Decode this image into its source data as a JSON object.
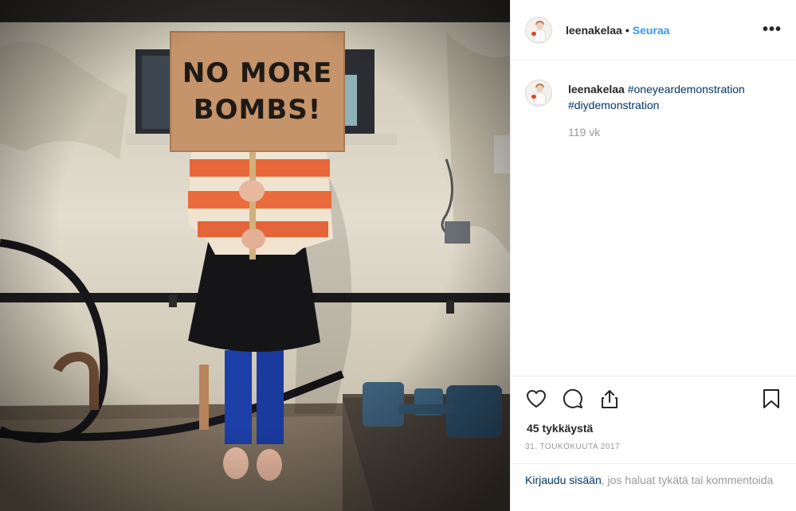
{
  "post": {
    "image": {
      "sign_line1": "NO MORE",
      "sign_line2": "BOMBS!"
    },
    "header": {
      "username": "leenakelaa",
      "dot": "•",
      "follow_label": "Seuraa",
      "more_label": "•••"
    },
    "caption": {
      "username": "leenakelaa",
      "hashtags": [
        "#oneyeardemonstration",
        "#diydemonstration"
      ],
      "time_ago": "119 vk"
    },
    "actions": {
      "like_icon": "heart-icon",
      "comment_icon": "comment-icon",
      "share_icon": "share-icon",
      "save_icon": "bookmark-icon"
    },
    "likes_text": "45 tykkäystä",
    "date_text": "31. TOUKOKUUTA 2017",
    "login": {
      "link_text": "Kirjaudu sisään",
      "rest_text": ", jos haluat tykätä tai kommentoida"
    },
    "colors": {
      "follow_blue": "#3897f0",
      "hashtag_blue": "#003569",
      "muted_gray": "#999999"
    }
  }
}
